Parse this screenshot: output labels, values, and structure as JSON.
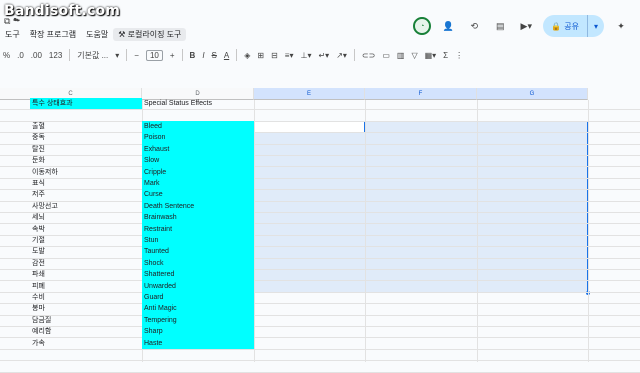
{
  "watermark": "Bandisoft.com",
  "menu": {
    "items": [
      {
        "label": "도구"
      },
      {
        "label": "확장 프로그램"
      },
      {
        "label": "도움말"
      },
      {
        "label": "로컬라이징 도구"
      }
    ]
  },
  "header": {
    "share_label": "공유"
  },
  "toolbar": {
    "zoom_partial": "%",
    "decimal_less": ".0",
    "decimal_more": ".00",
    "number_format": "123",
    "font_name": "기본값 ...",
    "font_minus": "−",
    "font_size": "10",
    "font_plus": "+",
    "bold": "B",
    "italic": "I",
    "strike": "S",
    "text_color": "A"
  },
  "columns": [
    {
      "letter": "C"
    },
    {
      "letter": "D"
    },
    {
      "letter": "E"
    },
    {
      "letter": "F"
    },
    {
      "letter": "G"
    }
  ],
  "header_row": {
    "c": "특수 상태효과",
    "d": "Special Status Effects"
  },
  "rows": [
    {
      "c": "출혈",
      "d": "Bleed"
    },
    {
      "c": "중독",
      "d": "Poison"
    },
    {
      "c": "탈진",
      "d": "Exhaust"
    },
    {
      "c": "둔화",
      "d": "Slow"
    },
    {
      "c": "이동저하",
      "d": "Cripple"
    },
    {
      "c": "표식",
      "d": "Mark"
    },
    {
      "c": "저주",
      "d": "Curse"
    },
    {
      "c": "사망선고",
      "d": "Death Sentence"
    },
    {
      "c": "세뇌",
      "d": "Brainwash"
    },
    {
      "c": "속박",
      "d": "Restraint"
    },
    {
      "c": "기절",
      "d": "Stun"
    },
    {
      "c": "도발",
      "d": "Taunted"
    },
    {
      "c": "감전",
      "d": "Shock"
    },
    {
      "c": "파쇄",
      "d": "Shattered"
    },
    {
      "c": "피폐",
      "d": "Unwarded"
    },
    {
      "c": "수비",
      "d": "Guard"
    },
    {
      "c": "봉마",
      "d": "Anti Magic"
    },
    {
      "c": "담금질",
      "d": "Tempering"
    },
    {
      "c": "예리함",
      "d": "Sharp"
    },
    {
      "c": "가속",
      "d": "Haste"
    }
  ],
  "colors": {
    "cyan_fill": "#00ffff",
    "selection_border": "#1a73e8",
    "selection_fill": "#d2e2f7",
    "share_bg": "#c2e7ff"
  }
}
